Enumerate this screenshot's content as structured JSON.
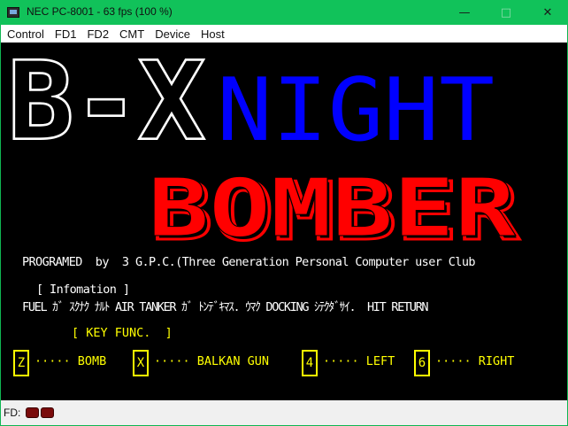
{
  "window": {
    "title": "NEC PC-8001 - 63 fps (100 %)",
    "minimize_glyph": "—",
    "maximize_glyph": "□",
    "close_glyph": "✕"
  },
  "menu": {
    "items": [
      "Control",
      "FD1",
      "FD2",
      "CMT",
      "Device",
      "Host"
    ]
  },
  "game": {
    "logo": {
      "bx": "B-X",
      "night": "NIGHT",
      "bomber": "BOMBER",
      "colors": {
        "bx": "#ffffff",
        "night": "#0000ff",
        "bomber": "#ff0000"
      }
    },
    "credit": "PROGRAMED  by  3 G.P.C.(Three Generation Personal Computer user Club",
    "info_header": "[ Infomation ]",
    "info_text": "FUEL ｶﾞ ｽｸﾅｸ ﾅﾙﾄ AIR TANKER ｶﾞ ﾄﾝﾃﾞｷﾏｽ. ｳﾏｸ DOCKING ｼﾃｸﾀﾞｻｲ.  HIT RETURN",
    "key_func_header": "[ KEY FUNC.  ]",
    "keys": [
      {
        "key": "Z",
        "label": "····· BOMB"
      },
      {
        "key": "X",
        "label": "····· BALKAN GUN"
      },
      {
        "key": "4",
        "label": "····· LEFT"
      },
      {
        "key": "6",
        "label": "····· RIGHT"
      }
    ],
    "text_colors": {
      "white": "#ffffff",
      "yellow": "#ffff00"
    }
  },
  "status": {
    "fd_label": "FD:",
    "fd_led_color": "#7a0a0a"
  }
}
